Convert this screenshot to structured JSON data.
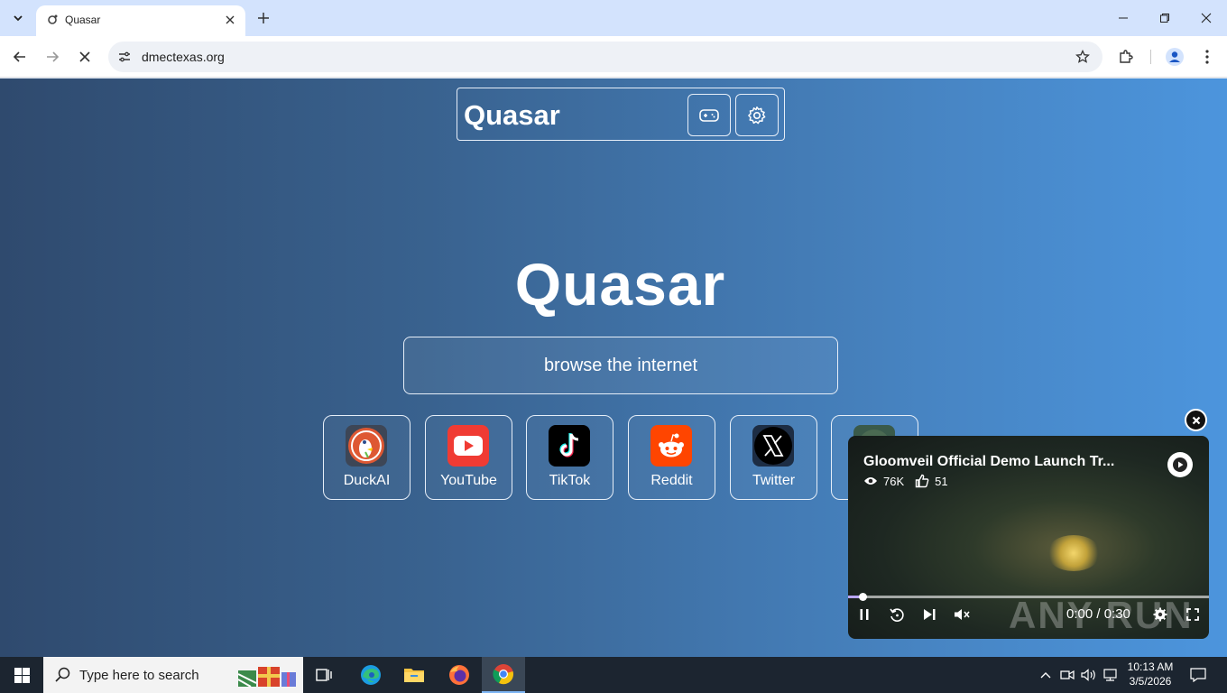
{
  "browser": {
    "tab_title": "Quasar",
    "url": "dmectexas.org"
  },
  "page": {
    "brand": "Quasar",
    "hero_title": "Quasar",
    "search_label": "browse the internet",
    "shortcuts": [
      {
        "label": "DuckAI",
        "icon": "duckduckgo-icon",
        "color": "#de5833"
      },
      {
        "label": "YouTube",
        "icon": "youtube-icon",
        "color": "#f03b33"
      },
      {
        "label": "TikTok",
        "icon": "tiktok-icon",
        "color": "#000000"
      },
      {
        "label": "Reddit",
        "icon": "reddit-icon",
        "color": "#ff4500"
      },
      {
        "label": "Twitter",
        "icon": "x-icon",
        "color": "#000000"
      },
      {
        "label": "",
        "icon": "app-icon",
        "color": "#4b6a52"
      }
    ]
  },
  "video": {
    "title": "Gloomveil Official Demo Launch Tr...",
    "views": "76K",
    "likes": "51",
    "time": "0:00 / 0:30",
    "progress": 0.04,
    "watermark": "ANY RUN"
  },
  "taskbar": {
    "search_placeholder": "Type here to search",
    "time": "10:13 AM",
    "date": "3/5/2026"
  }
}
